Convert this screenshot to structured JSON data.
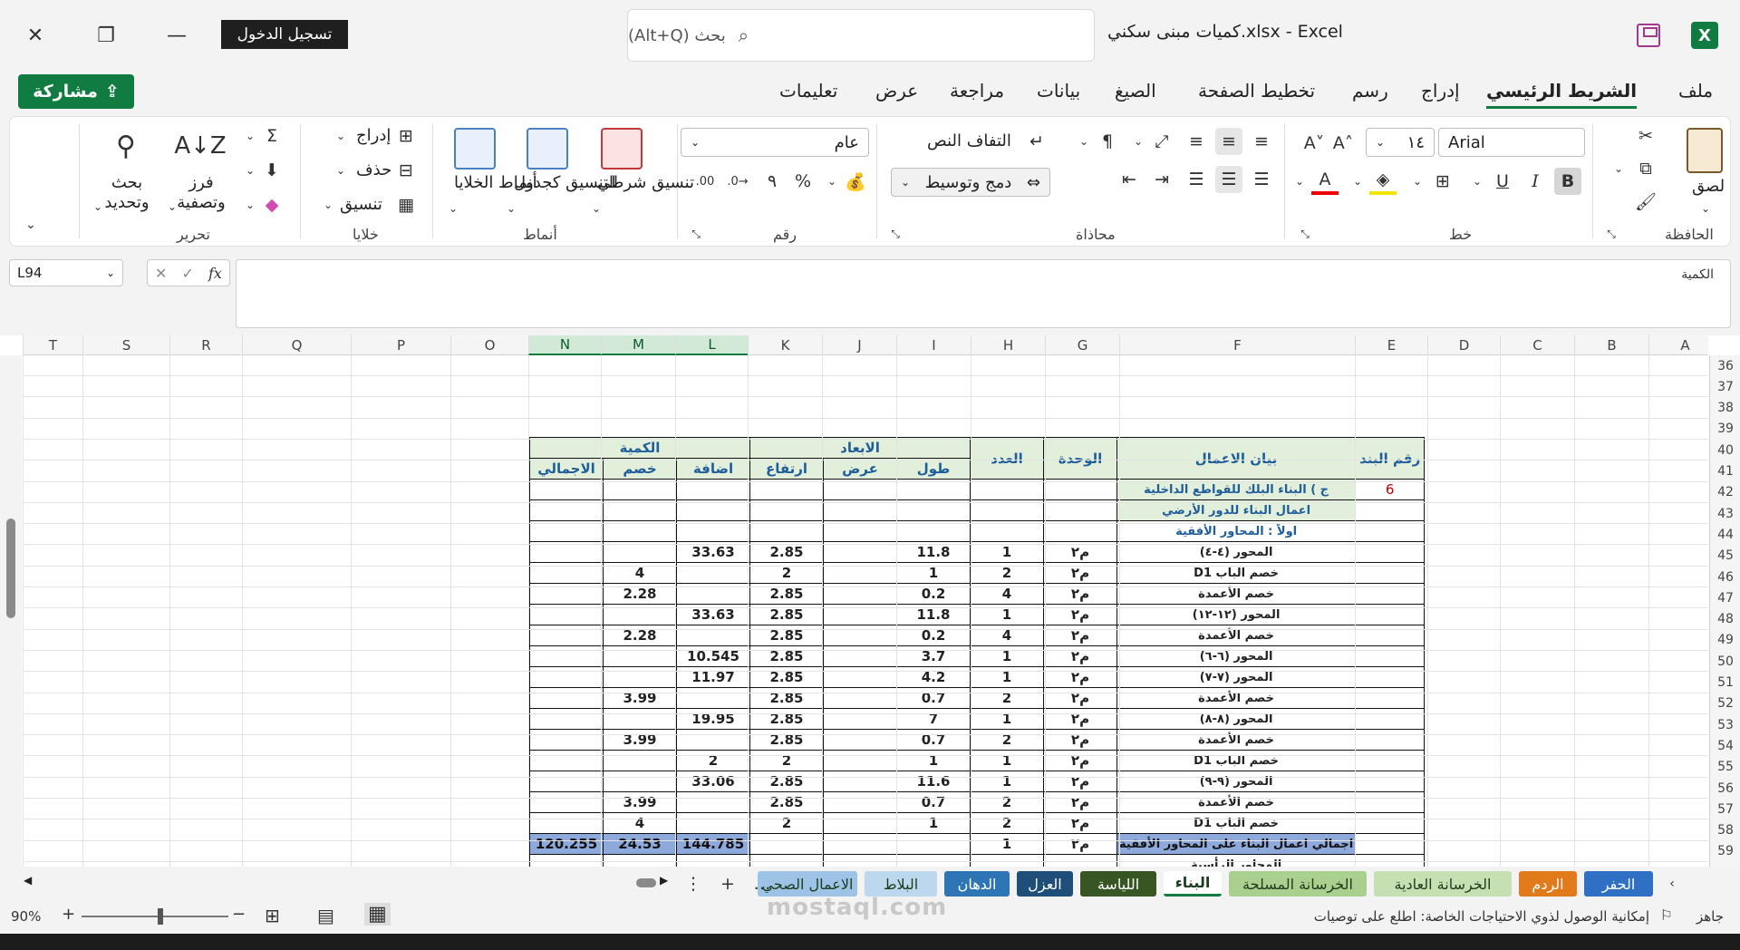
{
  "app": {
    "doc_title": "كميات مبنى سكني.xlsx  -  Excel",
    "signin": "تسجيل الدخول",
    "search_placeholder": "بحث (Alt+Q)",
    "share": "مشاركة"
  },
  "menu": [
    "ملف",
    "الشريط الرئيسي",
    "إدراج",
    "رسم",
    "تخطيط الصفحة",
    "الصيغ",
    "بيانات",
    "مراجعة",
    "عرض",
    "تعليمات"
  ],
  "ribbon": {
    "clipboard": {
      "label": "الحافظة",
      "paste": "لصق"
    },
    "font": {
      "label": "خط",
      "name": "Arial",
      "size": "١٤"
    },
    "alignment": {
      "label": "محاذاة",
      "wrap": "التفاف النص",
      "merge": "دمج وتوسيط"
    },
    "number": {
      "label": "رقم",
      "format": "عام"
    },
    "styles": {
      "label": "أنماط",
      "conditional": "تنسيق شرطي",
      "table": "التنسيق كجدول",
      "cell": "أنماط الخلايا"
    },
    "cells": {
      "label": "خلايا",
      "insert": "إدراج",
      "delete": "حذف",
      "format": "تنسيق"
    },
    "editing": {
      "label": "تحرير",
      "sort": "فرز وتصفية",
      "find": "بحث وتحديد"
    }
  },
  "formula": {
    "namebox": "L94",
    "label": "الكمية"
  },
  "columns": [
    "T",
    "S",
    "R",
    "Q",
    "P",
    "O",
    "N",
    "M",
    "L",
    "K",
    "J",
    "I",
    "H",
    "G",
    "F",
    "E",
    "D",
    "C",
    "B",
    "A"
  ],
  "rows": [
    "36",
    "37",
    "38",
    "39",
    "40",
    "41",
    "42",
    "43",
    "44",
    "45",
    "46",
    "47",
    "48",
    "49",
    "50",
    "51",
    "52",
    "53",
    "54",
    "55",
    "56",
    "57",
    "58",
    "59"
  ],
  "table": {
    "h_item": "رقم البند",
    "h_desc": "بيان الاعمال",
    "h_unit": "الوحدة",
    "h_count": "العدد",
    "h_dims": "الابعاد",
    "h_len": "طول",
    "h_wid": "عرض",
    "h_hgt": "ارتفاع",
    "h_qty": "الكمية",
    "h_add": "اضافة",
    "h_sub": "خصم",
    "h_total": "الاجمالي",
    "item_no": "6",
    "sec1": "ج ) البناء البلك للقواطع الداخلية",
    "sec2": "اعمال البناء للدور الأرضي",
    "sec3": "اولاً : المحاور الأفقية",
    "rows": [
      {
        "desc": "المحور (٤-٤)",
        "unit": "م٢",
        "count": "1",
        "len": "11.8",
        "wid": "",
        "hgt": "2.85",
        "add": "33.63",
        "sub": "",
        "total": ""
      },
      {
        "desc": "خصم الباب D1",
        "unit": "م٢",
        "count": "2",
        "len": "1",
        "wid": "",
        "hgt": "2",
        "add": "",
        "sub": "4",
        "total": ""
      },
      {
        "desc": "خصم الأعمدة",
        "unit": "م٢",
        "count": "4",
        "len": "0.2",
        "wid": "",
        "hgt": "2.85",
        "add": "",
        "sub": "2.28",
        "total": ""
      },
      {
        "desc": "المحور (١٢-١٢)",
        "unit": "م٢",
        "count": "1",
        "len": "11.8",
        "wid": "",
        "hgt": "2.85",
        "add": "33.63",
        "sub": "",
        "total": ""
      },
      {
        "desc": "خصم الأعمدة",
        "unit": "م٢",
        "count": "4",
        "len": "0.2",
        "wid": "",
        "hgt": "2.85",
        "add": "",
        "sub": "2.28",
        "total": ""
      },
      {
        "desc": "المحور (٦-٦)",
        "unit": "م٢",
        "count": "1",
        "len": "3.7",
        "wid": "",
        "hgt": "2.85",
        "add": "10.545",
        "sub": "",
        "total": ""
      },
      {
        "desc": "المحور (٧-٧)",
        "unit": "م٢",
        "count": "1",
        "len": "4.2",
        "wid": "",
        "hgt": "2.85",
        "add": "11.97",
        "sub": "",
        "total": ""
      },
      {
        "desc": "خصم الأعمدة",
        "unit": "م٢",
        "count": "2",
        "len": "0.7",
        "wid": "",
        "hgt": "2.85",
        "add": "",
        "sub": "3.99",
        "total": ""
      },
      {
        "desc": "المحور (٨-٨)",
        "unit": "م٢",
        "count": "1",
        "len": "7",
        "wid": "",
        "hgt": "2.85",
        "add": "19.95",
        "sub": "",
        "total": ""
      },
      {
        "desc": "خصم الأعمدة",
        "unit": "م٢",
        "count": "2",
        "len": "0.7",
        "wid": "",
        "hgt": "2.85",
        "add": "",
        "sub": "3.99",
        "total": ""
      },
      {
        "desc": "خصم الباب D1",
        "unit": "م٢",
        "count": "1",
        "len": "1",
        "wid": "",
        "hgt": "2",
        "add": "2",
        "sub": "",
        "total": ""
      },
      {
        "desc": "المحور (٩-٩)",
        "unit": "م٢",
        "count": "1",
        "len": "11.6",
        "wid": "",
        "hgt": "2.85",
        "add": "33.06",
        "sub": "",
        "total": ""
      },
      {
        "desc": "خصم الأعمدة",
        "unit": "م٢",
        "count": "2",
        "len": "0.7",
        "wid": "",
        "hgt": "2.85",
        "add": "",
        "sub": "3.99",
        "total": ""
      },
      {
        "desc": "خصم الباب D1",
        "unit": "م٢",
        "count": "2",
        "len": "1",
        "wid": "",
        "hgt": "2",
        "add": "",
        "sub": "4",
        "total": ""
      }
    ],
    "total_row": {
      "desc": "اجمالي اعمال البناء على المحاور الأفقية",
      "unit": "م٢",
      "count": "1",
      "add": "144.785",
      "sub": "24.53",
      "total": "120.255"
    },
    "next_row": "المحاور الرأسية"
  },
  "sheets": [
    {
      "name": "الحفر",
      "color": "#2f6fc4"
    },
    {
      "name": "الردم",
      "color": "#e07a1a"
    },
    {
      "name": "الخرسانة العادية",
      "color": "#c6e0b4",
      "dark": true
    },
    {
      "name": "الخرسانة المسلحة",
      "color": "#a9d08e",
      "dark": true
    },
    {
      "name": "البناء",
      "color": "#e2efda",
      "dark": true,
      "active": true
    },
    {
      "name": "اللياسة",
      "color": "#375623"
    },
    {
      "name": "العزل",
      "color": "#1f4e79"
    },
    {
      "name": "الدهان",
      "color": "#2e75b6"
    },
    {
      "name": "البلاط",
      "color": "#bdd7ee",
      "dark": true
    },
    {
      "name": "الاعمال الصحي",
      "color": "#9dc3e6",
      "dark": true
    }
  ],
  "status": {
    "ready": "جاهز",
    "accessibility": "إمكانية الوصول لذوي الاحتياجات الخاصة: اطلع على توصيات",
    "zoom": "90%"
  },
  "watermark": "mostaql.com"
}
